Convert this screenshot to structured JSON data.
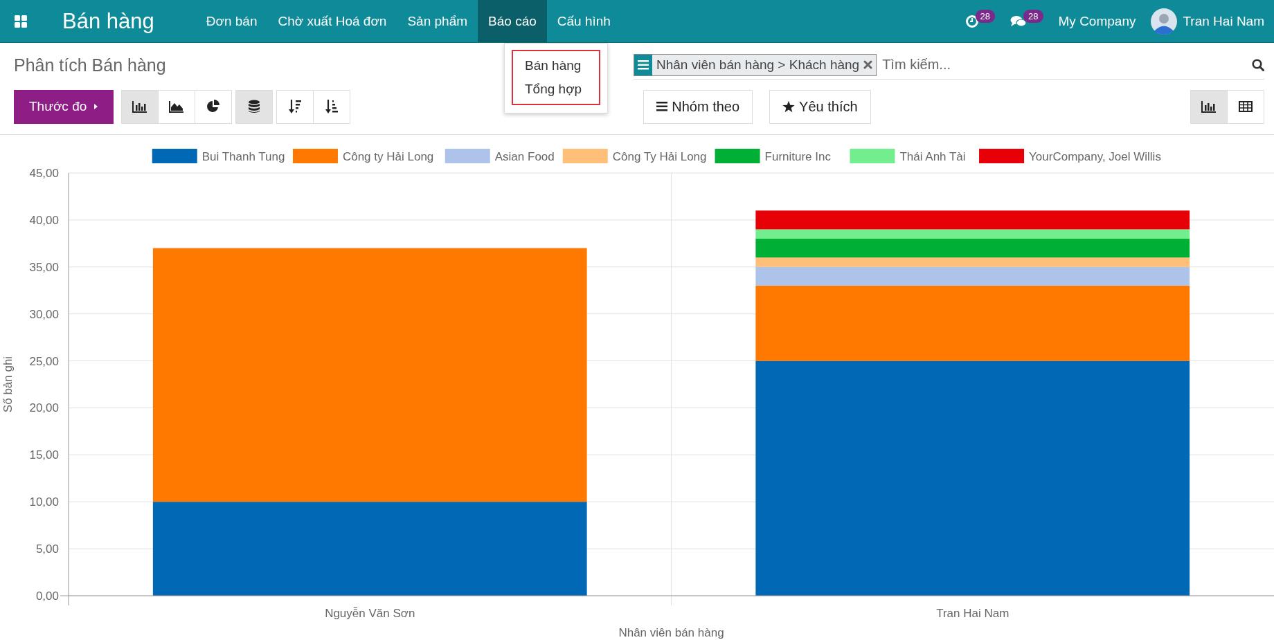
{
  "app": {
    "title": "Bán hàng"
  },
  "nav": [
    {
      "label": "Đơn bán",
      "selected": false
    },
    {
      "label": "Chờ xuất Hoá đơn",
      "selected": false
    },
    {
      "label": "Sản phẩm",
      "selected": false
    },
    {
      "label": "Báo cáo",
      "selected": true
    },
    {
      "label": "Cấu hình",
      "selected": false
    }
  ],
  "systray": {
    "activity_count": "28",
    "message_count": "28",
    "company": "My Company",
    "user": "Tran Hai Nam"
  },
  "dropdown": {
    "items": [
      "Bán hàng",
      "Tổng hợp"
    ]
  },
  "breadcrumb": "Phân tích Bán hàng",
  "search": {
    "facets": [
      {
        "label": "Nhân viên bán hàng > Khách hàng"
      }
    ],
    "placeholder": "Tìm kiếm..."
  },
  "measures_button": "Thước đo",
  "chart_modes": [
    {
      "kind": "bar",
      "selected": true
    },
    {
      "kind": "line",
      "selected": false
    },
    {
      "kind": "pie",
      "selected": false
    }
  ],
  "stacked": true,
  "buttons": [
    {
      "kind": "group",
      "label": "Nhóm theo"
    },
    {
      "kind": "favorite",
      "label": "Yêu thích"
    }
  ],
  "views": [
    {
      "kind": "graph",
      "selected": true
    },
    {
      "kind": "pivot",
      "selected": false
    }
  ],
  "chart_data": {
    "type": "bar",
    "stacked": true,
    "grid": true,
    "legend": "top",
    "xlabel": "Nhân viên bán hàng",
    "ylabel": "Số bản ghi",
    "categories": [
      "Nguyễn Văn Sơn",
      "Tran Hai Nam"
    ],
    "ylim": [
      0,
      45
    ],
    "yticks": [
      {
        "value": 0,
        "label": "0,00"
      },
      {
        "value": 5,
        "label": "5,00"
      },
      {
        "value": 10,
        "label": "10,00"
      },
      {
        "value": 15,
        "label": "15,00"
      },
      {
        "value": 20,
        "label": "20,00"
      },
      {
        "value": 25,
        "label": "25,00"
      },
      {
        "value": 30,
        "label": "30,00"
      },
      {
        "value": 35,
        "label": "35,00"
      },
      {
        "value": 40,
        "label": "40,00"
      },
      {
        "value": 45,
        "label": "45,00"
      }
    ],
    "series": [
      {
        "name": "Bui Thanh Tung",
        "color": "#0068b5",
        "values": [
          10,
          25
        ]
      },
      {
        "name": "Công ty Hải Long",
        "color": "#ff7800",
        "values": [
          27,
          8
        ]
      },
      {
        "name": "Asian Food",
        "color": "#aec3ea",
        "values": [
          0,
          2
        ]
      },
      {
        "name": "Công Ty Hải Long",
        "color": "#ffbf78",
        "values": [
          0,
          1
        ]
      },
      {
        "name": "Furniture Inc",
        "color": "#00b035",
        "values": [
          0,
          2
        ]
      },
      {
        "name": "Thái Anh Tài",
        "color": "#73ee8e",
        "values": [
          0,
          1
        ]
      },
      {
        "name": "YourCompany, Joel Willis",
        "color": "#e80008",
        "values": [
          0,
          2
        ]
      }
    ]
  }
}
